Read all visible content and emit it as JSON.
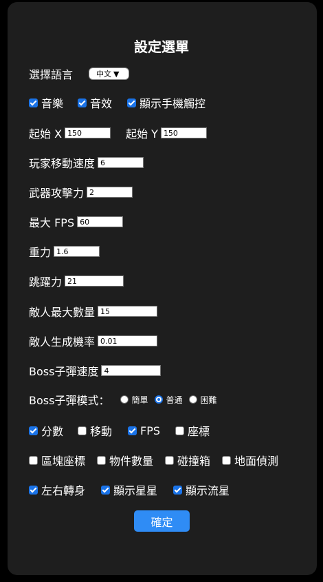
{
  "title": "設定選單",
  "language": {
    "label": "選擇語言",
    "selected": "中文",
    "arrow": "▼"
  },
  "toggles_row1": [
    {
      "label": "音樂",
      "checked": true
    },
    {
      "label": "音效",
      "checked": true
    },
    {
      "label": "顯示手機觸控",
      "checked": true
    }
  ],
  "start": {
    "x_label": "起始 X",
    "x_value": "150",
    "y_label": "起始 Y",
    "y_value": "150"
  },
  "fields": {
    "player_speed": {
      "label": "玩家移動速度",
      "value": "6"
    },
    "weapon_attack": {
      "label": "武器攻擊力",
      "value": "2"
    },
    "max_fps": {
      "label": "最大 FPS",
      "value": "60"
    },
    "gravity": {
      "label": "重力",
      "value": "1.6"
    },
    "jump": {
      "label": "跳躍力",
      "value": "21"
    },
    "enemy_max": {
      "label": "敵人最大數量",
      "value": "15"
    },
    "enemy_rate": {
      "label": "敵人生成機率",
      "value": "0.01"
    },
    "boss_bullet_speed": {
      "label": "Boss子彈速度",
      "value": "4"
    }
  },
  "boss_mode": {
    "label": "Boss子彈模式：",
    "options": [
      "簡單",
      "普通",
      "困難"
    ],
    "selected": "普通"
  },
  "debug_row1": [
    {
      "label": "分數",
      "checked": true
    },
    {
      "label": "移動",
      "checked": false
    },
    {
      "label": "FPS",
      "checked": true
    },
    {
      "label": "座標",
      "checked": false
    }
  ],
  "debug_row2": [
    {
      "label": "區塊座標",
      "checked": false
    },
    {
      "label": "物件數量",
      "checked": false
    },
    {
      "label": "碰撞箱",
      "checked": false
    },
    {
      "label": "地面偵測",
      "checked": false
    }
  ],
  "visual_row": [
    {
      "label": "左右轉身",
      "checked": true
    },
    {
      "label": "顯示星星",
      "checked": true
    },
    {
      "label": "顯示流星",
      "checked": true
    }
  ],
  "confirm_label": "確定",
  "colors": {
    "accent": "#1a73e8",
    "button": "#2f8cf5",
    "panel": "#1e1e1e",
    "background": "#000000"
  }
}
